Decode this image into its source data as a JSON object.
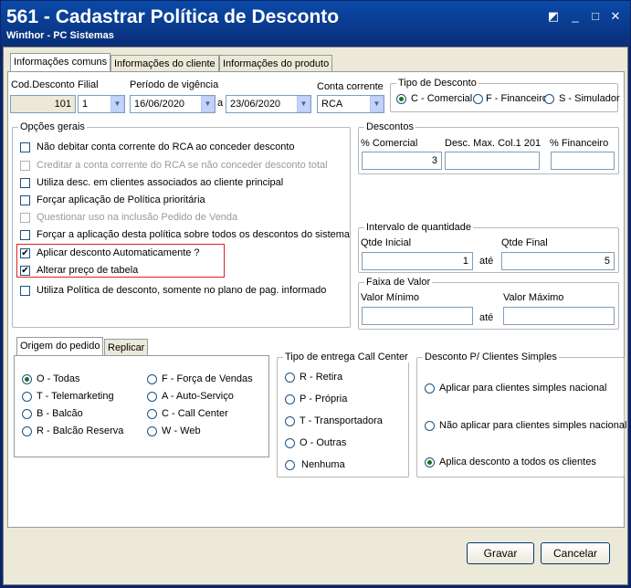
{
  "window": {
    "title": "561 - Cadastrar Política de Desconto",
    "subtitle": "Winthor - PC Sistemas"
  },
  "tabs": [
    "Informações comuns",
    "Informações do cliente",
    "Informações do produto"
  ],
  "header": {
    "cod_label": "Cod.Desconto",
    "cod_value": "101",
    "filial_label": "Filial",
    "filial_value": "1",
    "periodo_label": "Período de vigência",
    "date_from": "16/06/2020",
    "a_label": "a",
    "date_to": "23/06/2020",
    "conta_label": "Conta corrente",
    "conta_value": "RCA"
  },
  "tipo_desconto": {
    "title": "Tipo de Desconto",
    "options": [
      "C - Comercial",
      "F - Financeiro",
      "S - Simulador"
    ],
    "selected": 0
  },
  "opcoes": {
    "title": "Opções gerais",
    "items": [
      {
        "label": "Não debitar conta corrente do RCA ao conceder desconto",
        "checked": false,
        "disabled": false
      },
      {
        "label": "Creditar a conta corrente do RCA se não conceder desconto total",
        "checked": false,
        "disabled": true
      },
      {
        "label": "Utiliza desc. em clientes associados ao cliente principal",
        "checked": false,
        "disabled": false
      },
      {
        "label": "Forçar aplicação de Política prioritária",
        "checked": false,
        "disabled": false
      },
      {
        "label": "Questionar uso na inclusão Pedido de Venda",
        "checked": false,
        "disabled": true
      },
      {
        "label": "Forçar a aplicação desta política sobre todos os descontos do sistema",
        "checked": false,
        "disabled": false
      },
      {
        "label": "Aplicar desconto Automaticamente ?",
        "checked": true,
        "disabled": false
      },
      {
        "label": "Alterar preço de tabela",
        "checked": true,
        "disabled": false
      },
      {
        "label": "Utiliza Política de desconto, somente no plano de pag. informado",
        "checked": false,
        "disabled": false
      }
    ]
  },
  "descontos": {
    "title": "Descontos",
    "comercial_label": "% Comercial",
    "comercial_value": "3",
    "max_label": "Desc. Max. Col.1 201",
    "max_value": "",
    "financeiro_label": "% Financeiro",
    "financeiro_value": ""
  },
  "intervalo": {
    "title": "Intervalo de quantidade",
    "inicial_label": "Qtde Inicial",
    "inicial_value": "1",
    "ate": "até",
    "final_label": "Qtde Final",
    "final_value": "5"
  },
  "faixa": {
    "title": "Faixa de Valor",
    "min_label": "Valor Mínimo",
    "max_label": "Valor Máximo",
    "ate": "até",
    "min_value": "",
    "max_value": ""
  },
  "subtabs": [
    "Origem do pedido",
    "Replicar"
  ],
  "origem": {
    "col1": [
      "O - Todas",
      "T - Telemarketing",
      "B - Balcão",
      "R - Balcão Reserva"
    ],
    "col2": [
      "F - Força de Vendas",
      "A - Auto-Serviço",
      "C - Call Center",
      "W - Web"
    ],
    "selected": "O - Todas"
  },
  "entrega": {
    "title": "Tipo de entrega Call Center",
    "options": [
      "R - Retira",
      "P - Própria",
      "T - Transportadora",
      "O - Outras",
      "Nenhuma"
    ]
  },
  "simples": {
    "title": "Desconto P/ Clientes Simples",
    "options": [
      "Aplicar para clientes simples nacional",
      "Não aplicar para clientes simples nacional",
      "Aplica desconto a todos os clientes"
    ],
    "selected": 2
  },
  "buttons": {
    "gravar": "Gravar",
    "cancelar": "Cancelar"
  }
}
